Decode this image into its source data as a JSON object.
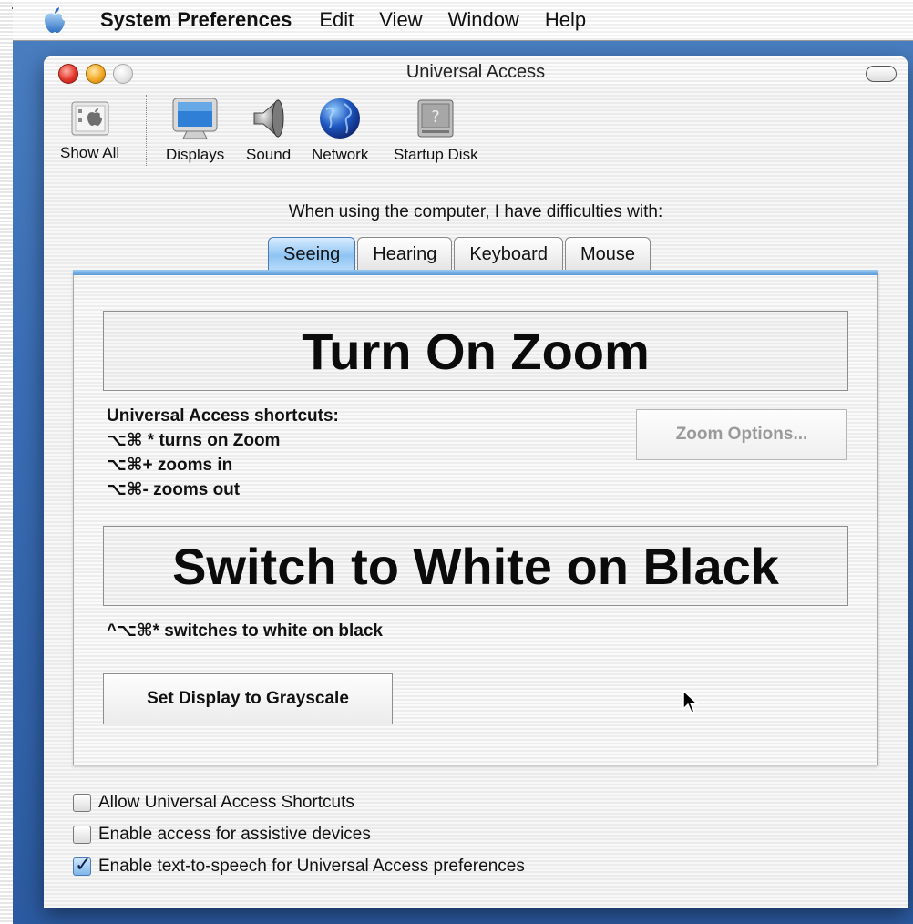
{
  "menubar": {
    "app_name": "System Preferences",
    "items": [
      "Edit",
      "View",
      "Window",
      "Help"
    ]
  },
  "window": {
    "title": "Universal Access"
  },
  "toolbar": {
    "items": [
      {
        "label": "Show All",
        "icon": "show-all-icon"
      },
      {
        "label": "Displays",
        "icon": "display-icon"
      },
      {
        "label": "Sound",
        "icon": "speaker-icon"
      },
      {
        "label": "Network",
        "icon": "globe-icon"
      },
      {
        "label": "Startup Disk",
        "icon": "hard-disk-icon"
      }
    ]
  },
  "prompt": "When using the computer, I have difficulties with:",
  "tabs": [
    "Seeing",
    "Hearing",
    "Keyboard",
    "Mouse"
  ],
  "active_tab": "Seeing",
  "seeing": {
    "zoom_button": "Turn On Zoom",
    "shortcuts_title": "Universal Access shortcuts:",
    "shortcut_1": "⌥⌘ * turns on Zoom",
    "shortcut_2": "⌥⌘+ zooms in",
    "shortcut_3": "⌥⌘- zooms out",
    "zoom_options": "Zoom Options...",
    "wob_button": "Switch to White on Black",
    "wob_shortcut": "^⌥⌘* switches to white on black",
    "grayscale_button": "Set Display to Grayscale"
  },
  "checkboxes": [
    {
      "label": "Allow Universal Access Shortcuts",
      "checked": false
    },
    {
      "label": "Enable access for assistive devices",
      "checked": false
    },
    {
      "label": "Enable text-to-speech for Universal Access preferences",
      "checked": true
    }
  ],
  "colors": {
    "desktop": "#3a6db4",
    "tab_active": "#8ec4f2",
    "close": "#e2342a",
    "minimize": "#f3a925"
  }
}
